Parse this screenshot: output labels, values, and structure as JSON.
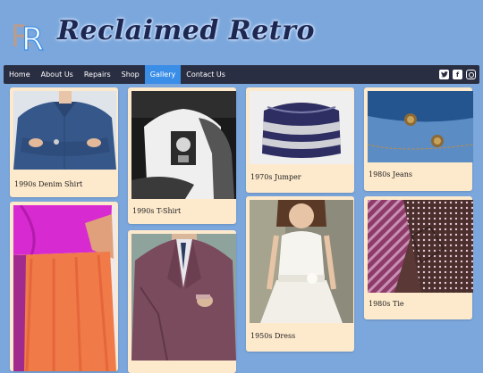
{
  "site": {
    "title": "Reclaimed Retro",
    "logo_letters": "RR"
  },
  "nav": {
    "items": [
      {
        "label": "Home",
        "active": false
      },
      {
        "label": "About Us",
        "active": false
      },
      {
        "label": "Repairs",
        "active": false
      },
      {
        "label": "Shop",
        "active": false
      },
      {
        "label": "Gallery",
        "active": true
      },
      {
        "label": "Contact Us",
        "active": false
      }
    ],
    "social": [
      "twitter-icon",
      "facebook-icon",
      "instagram-icon"
    ]
  },
  "gallery": {
    "items": [
      {
        "caption": "1990s Denim Shirt"
      },
      {
        "caption": "1990s T-Shirt"
      },
      {
        "caption": "1970s Jumper"
      },
      {
        "caption": "1980s Jeans"
      },
      {
        "caption": ""
      },
      {
        "caption": ""
      },
      {
        "caption": "1950s Dress"
      },
      {
        "caption": "1980s Tie"
      }
    ]
  },
  "colors": {
    "background": "#7ba7dc",
    "nav_background": "#2a2e42",
    "nav_active": "#3b8ee8",
    "card": "#fde9cc",
    "title": "#1c2852"
  }
}
